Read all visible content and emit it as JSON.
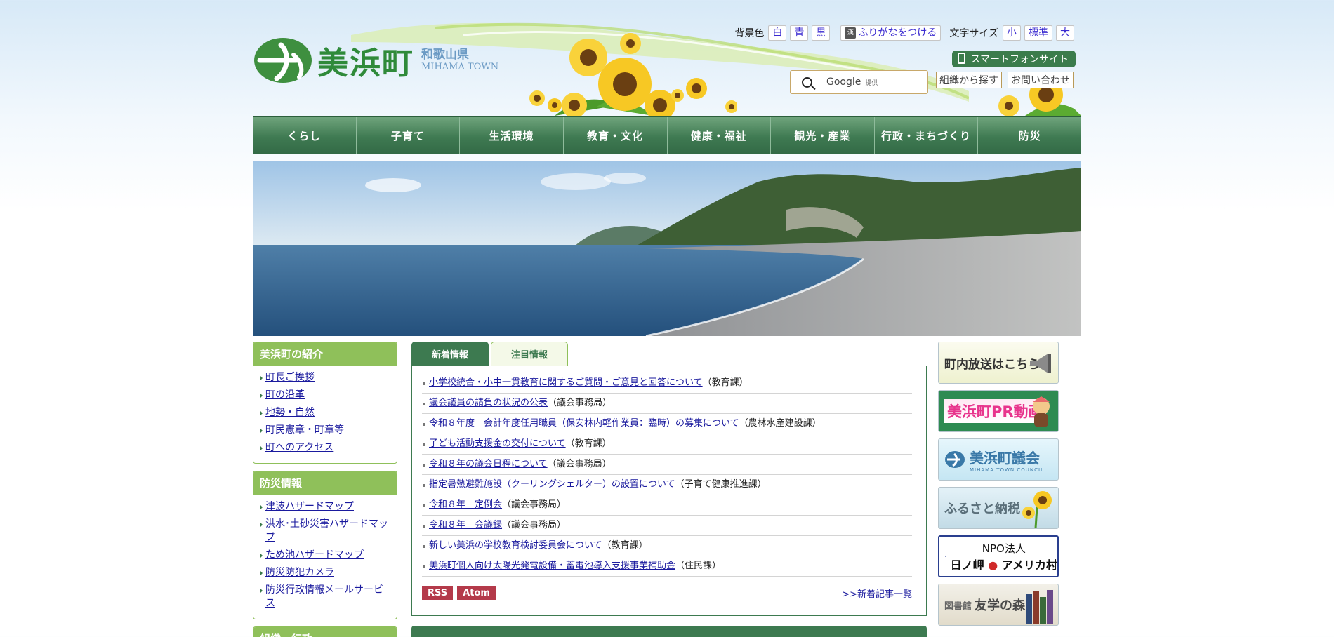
{
  "header": {
    "logo_name": "美浜町",
    "logo_prefecture": "和歌山県",
    "logo_english": "MIHAMA TOWN",
    "bg_color_label": "背景色",
    "bg_colors": [
      "白",
      "青",
      "黒"
    ],
    "furigana": "ふりがなをつける",
    "furigana_icon_text": "漢",
    "font_size_label": "文字サイズ",
    "font_sizes": [
      "小",
      "標準",
      "大"
    ],
    "smartphone": "スマートフォンサイト",
    "search_brand": "Google",
    "search_provided": "提供",
    "org_search": "組織から探す",
    "contact": "お問い合わせ"
  },
  "nav": [
    "くらし",
    "子育て",
    "生活環境",
    "教育・文化",
    "健康・福祉",
    "観光・産業",
    "行政・まちづくり",
    "防災"
  ],
  "sidebar": {
    "intro": {
      "title": "美浜町の紹介",
      "items": [
        "町長ご挨拶",
        "町の沿革",
        "地勢・自然",
        "町民憲章・町章等",
        "町へのアクセス"
      ]
    },
    "disaster": {
      "title": "防災情報",
      "items": [
        "津波ハザードマップ",
        "洪水･土砂災害ハザードマップ",
        "ため池ハザードマップ",
        "防災防犯カメラ",
        "防災行政情報メールサービス"
      ]
    },
    "next_title": "組織・行政"
  },
  "tabs": [
    "新着情報",
    "注目情報"
  ],
  "news": [
    {
      "title": "小学校統合・小中一貫教育に関するご質問・ご意見と回答について",
      "dept": "（教育課）"
    },
    {
      "title": "議会議員の請負の状況の公表",
      "dept": "（議会事務局）"
    },
    {
      "title": "令和８年度　会計年度任用職員（保安林内軽作業員：臨時）の募集について",
      "dept": "（農林水産建設課）"
    },
    {
      "title": "子ども活動支援金の交付について",
      "dept": "（教育課）"
    },
    {
      "title": "令和８年の議会日程について",
      "dept": "（議会事務局）"
    },
    {
      "title": "指定暑熱避難施設（クーリングシェルター）の設置について",
      "dept": "（子育て健康推進課）"
    },
    {
      "title": "令和８年　定例会",
      "dept": "（議会事務局）"
    },
    {
      "title": "令和８年　会議録",
      "dept": "（議会事務局）"
    },
    {
      "title": "新しい美浜の学校教育検討委員会について",
      "dept": "（教育課）"
    },
    {
      "title": "美浜町個人向け太陽光発電設備・蓄電池導入支援事業補助金",
      "dept": "（住民課）"
    }
  ],
  "feeds": [
    "RSS",
    "Atom"
  ],
  "more_link": ">>新着記事一覧",
  "banners": {
    "broadcast": "町内放送はこちら",
    "pr_video": "美浜町PR動画",
    "council": "美浜町議会",
    "council_en": "MIHAMA TOWN COUNCIL",
    "furusato": "ふるさと納税",
    "npo_top": "NPO法人",
    "npo_left": "日ノ岬",
    "npo_right": "アメリカ村",
    "library_small": "図書館",
    "library_big": "友学の森"
  },
  "colors": {
    "nav_green": "#3f7a52",
    "side_green": "#8fc05a",
    "feed_red": "#b43a4a"
  }
}
